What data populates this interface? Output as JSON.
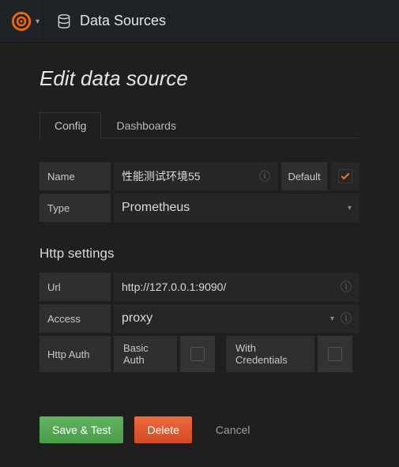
{
  "topbar": {
    "title": "Data Sources"
  },
  "page": {
    "title": "Edit data source"
  },
  "tabs": {
    "config": "Config",
    "dashboards": "Dashboards"
  },
  "form": {
    "name_label": "Name",
    "name_value": "性能测试环境55",
    "default_label": "Default",
    "type_label": "Type",
    "type_value": "Prometheus"
  },
  "http": {
    "heading": "Http settings",
    "url_label": "Url",
    "url_value": "http://127.0.0.1:9090/",
    "access_label": "Access",
    "access_value": "proxy",
    "auth_label": "Http Auth",
    "basic_auth": "Basic Auth",
    "with_credentials": "With Credentials"
  },
  "buttons": {
    "save": "Save & Test",
    "delete": "Delete",
    "cancel": "Cancel"
  }
}
